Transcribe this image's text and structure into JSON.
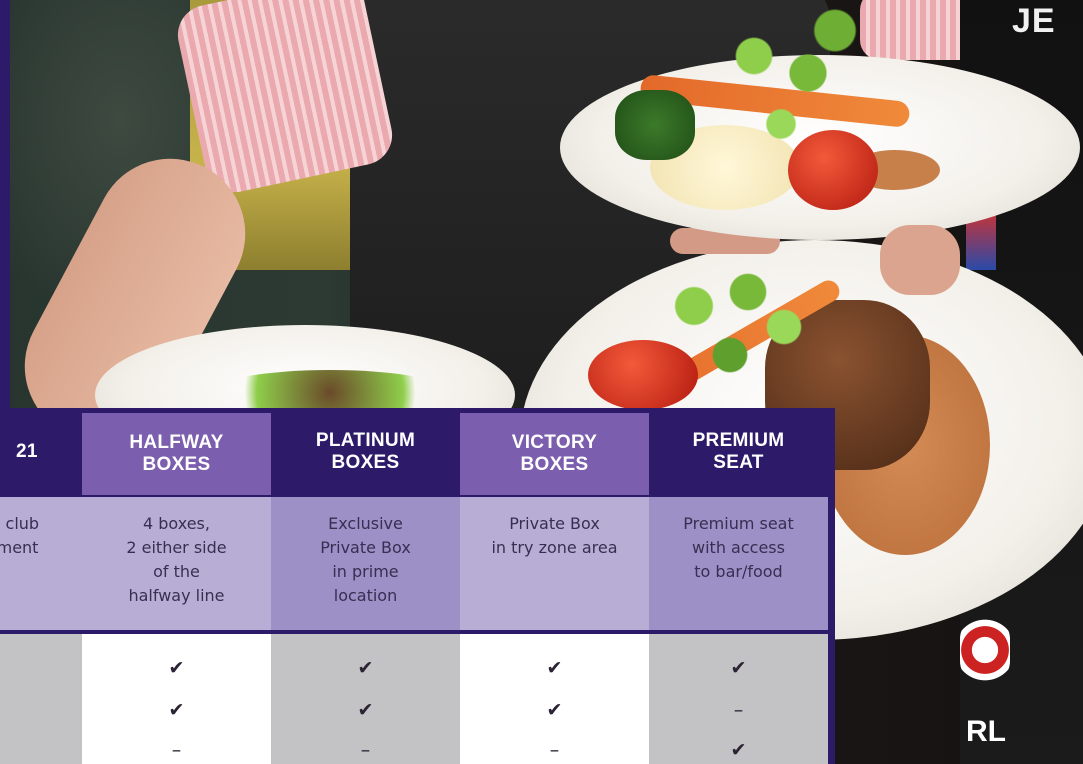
{
  "background": {
    "sign_text": "JE",
    "logo_text": "RL"
  },
  "table": {
    "columns": [
      {
        "title": "21",
        "description": "l club\nment",
        "ticks": [
          "",
          "",
          ""
        ]
      },
      {
        "title": "HALFWAY\nBOXES",
        "description": "4 boxes,\n2 either side\nof the\nhalfway line",
        "ticks": [
          "✔",
          "✔",
          "–"
        ]
      },
      {
        "title": "PLATINUM\nBOXES",
        "description": "Exclusive\nPrivate Box\nin prime\nlocation",
        "ticks": [
          "✔",
          "✔",
          "–"
        ]
      },
      {
        "title": "VICTORY\nBOXES",
        "description": "Private Box\nin try zone area",
        "ticks": [
          "✔",
          "✔",
          "–"
        ]
      },
      {
        "title": "PREMIUM\nSEAT",
        "description": "Premium seat\nwith access\nto bar/food",
        "ticks": [
          "✔",
          "–",
          "✔"
        ]
      }
    ]
  },
  "colors": {
    "dark_purple": "#2d1b69",
    "mid_purple": "#7b5fae",
    "light_lavender": "#b8aed5",
    "lavender": "#9d90c6",
    "grey": "#c3c3c5"
  }
}
